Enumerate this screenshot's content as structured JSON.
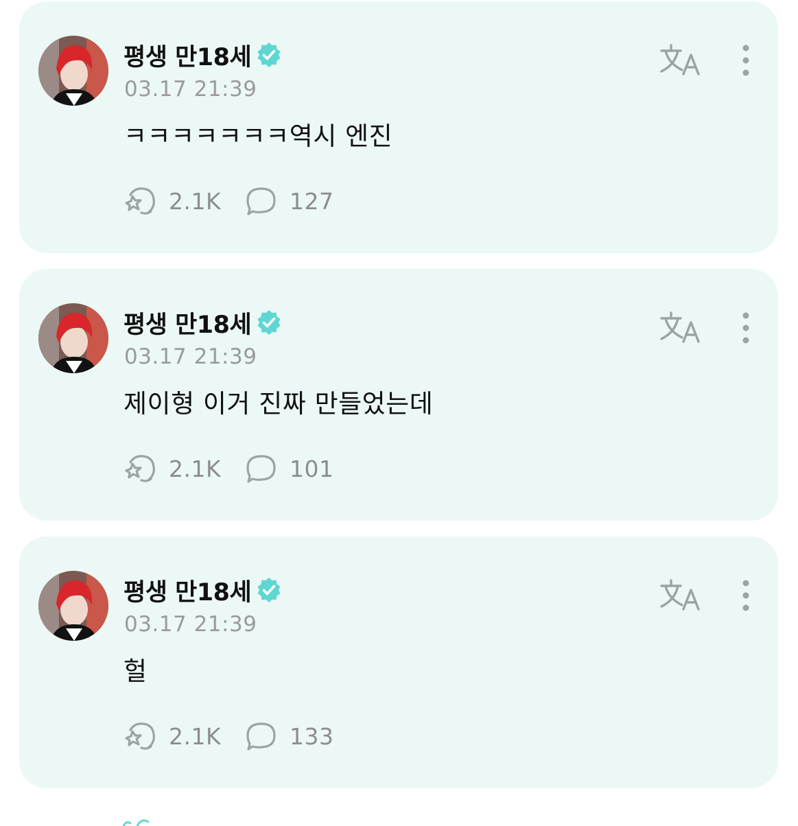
{
  "posts": [
    {
      "author": "평생 만18세",
      "time": "03.17 21:39",
      "text": "ㅋㅋㅋㅋㅋㅋㅋ역시 엔진",
      "likes": "2.1K",
      "comments": "127"
    },
    {
      "author": "평생 만18세",
      "time": "03.17 21:39",
      "text": "제이형 이거 진짜 만들었는데",
      "likes": "2.1K",
      "comments": "101"
    },
    {
      "author": "평생 만18세",
      "time": "03.17 21:39",
      "text": "헐",
      "likes": "2.1K",
      "comments": "133"
    }
  ],
  "icons": {
    "verified": "verified-badge-icon",
    "translate": "translate-icon",
    "more": "more-vertical-icon",
    "like": "like-reaction-icon",
    "comment": "comment-bubble-icon"
  },
  "colors": {
    "card_background": "#ebf8f6",
    "verified_badge": "#5fd6d2",
    "icon_gray": "#9aa5a3",
    "timestamp_gray": "#9a9a9a",
    "text_primary": "#111111"
  }
}
